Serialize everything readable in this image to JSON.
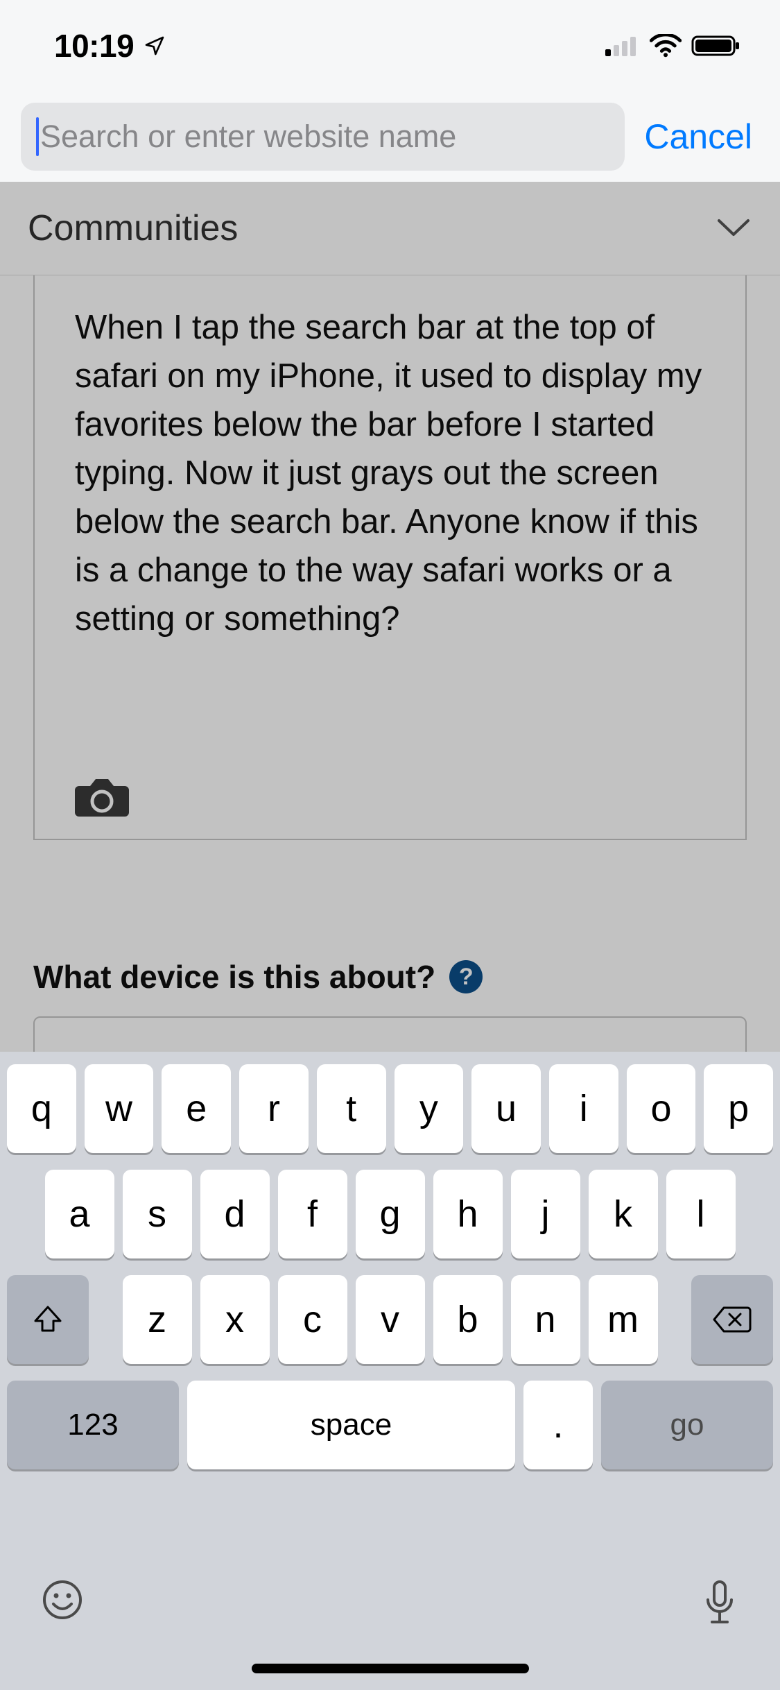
{
  "status": {
    "time": "10:19"
  },
  "chrome": {
    "search_placeholder": "Search or enter website name",
    "cancel": "Cancel"
  },
  "page": {
    "community_header": "Communities",
    "post_body": "When I tap the search bar at the top of safari on my iPhone, it used to display my favorites below the bar before I started typing. Now it just grays out the screen below the search bar. Anyone know if this is a change to the way safari works or a setting or something?",
    "device_question": "What device is this about?",
    "help_glyph": "?"
  },
  "keyboard": {
    "row1": [
      "q",
      "w",
      "e",
      "r",
      "t",
      "y",
      "u",
      "i",
      "o",
      "p"
    ],
    "row2": [
      "a",
      "s",
      "d",
      "f",
      "g",
      "h",
      "j",
      "k",
      "l"
    ],
    "row3": [
      "z",
      "x",
      "c",
      "v",
      "b",
      "n",
      "m"
    ],
    "numbers_label": "123",
    "space_label": "space",
    "dot_label": ".",
    "go_label": "go"
  }
}
